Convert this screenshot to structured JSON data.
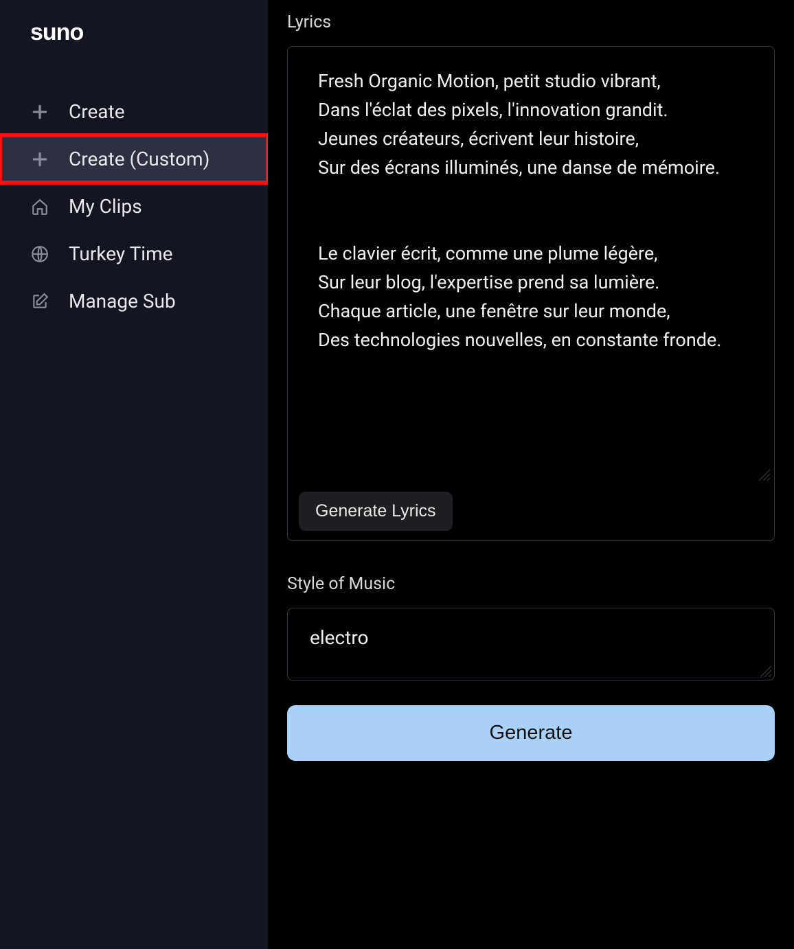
{
  "logo_text": "suno",
  "sidebar": {
    "items": [
      {
        "label": "Create",
        "icon": "plus-icon",
        "active": false,
        "highlighted": false
      },
      {
        "label": "Create (Custom)",
        "icon": "plus-icon",
        "active": true,
        "highlighted": true
      },
      {
        "label": "My Clips",
        "icon": "home-icon",
        "active": false,
        "highlighted": false
      },
      {
        "label": "Turkey Time",
        "icon": "globe-icon",
        "active": false,
        "highlighted": false
      },
      {
        "label": "Manage Sub",
        "icon": "edit-icon",
        "active": false,
        "highlighted": false
      }
    ]
  },
  "main": {
    "lyrics_label": "Lyrics",
    "lyrics_value": "Fresh Organic Motion, petit studio vibrant,\nDans l'éclat des pixels, l'innovation grandit.\nJeunes créateurs, écrivent leur histoire,\nSur des écrans illuminés, une danse de mémoire.\n\n\nLe clavier écrit, comme une plume légère,\nSur leur blog, l'expertise prend sa lumière.\nChaque article, une fenêtre sur leur monde,\nDes technologies nouvelles, en constante fronde.",
    "generate_lyrics_label": "Generate Lyrics",
    "style_label": "Style of Music",
    "style_value": "electro",
    "generate_label": "Generate"
  },
  "colors": {
    "sidebar_bg": "#131521",
    "main_bg": "#000000",
    "accent_button": "#a9d0f5",
    "highlight_border": "#ff1010"
  }
}
